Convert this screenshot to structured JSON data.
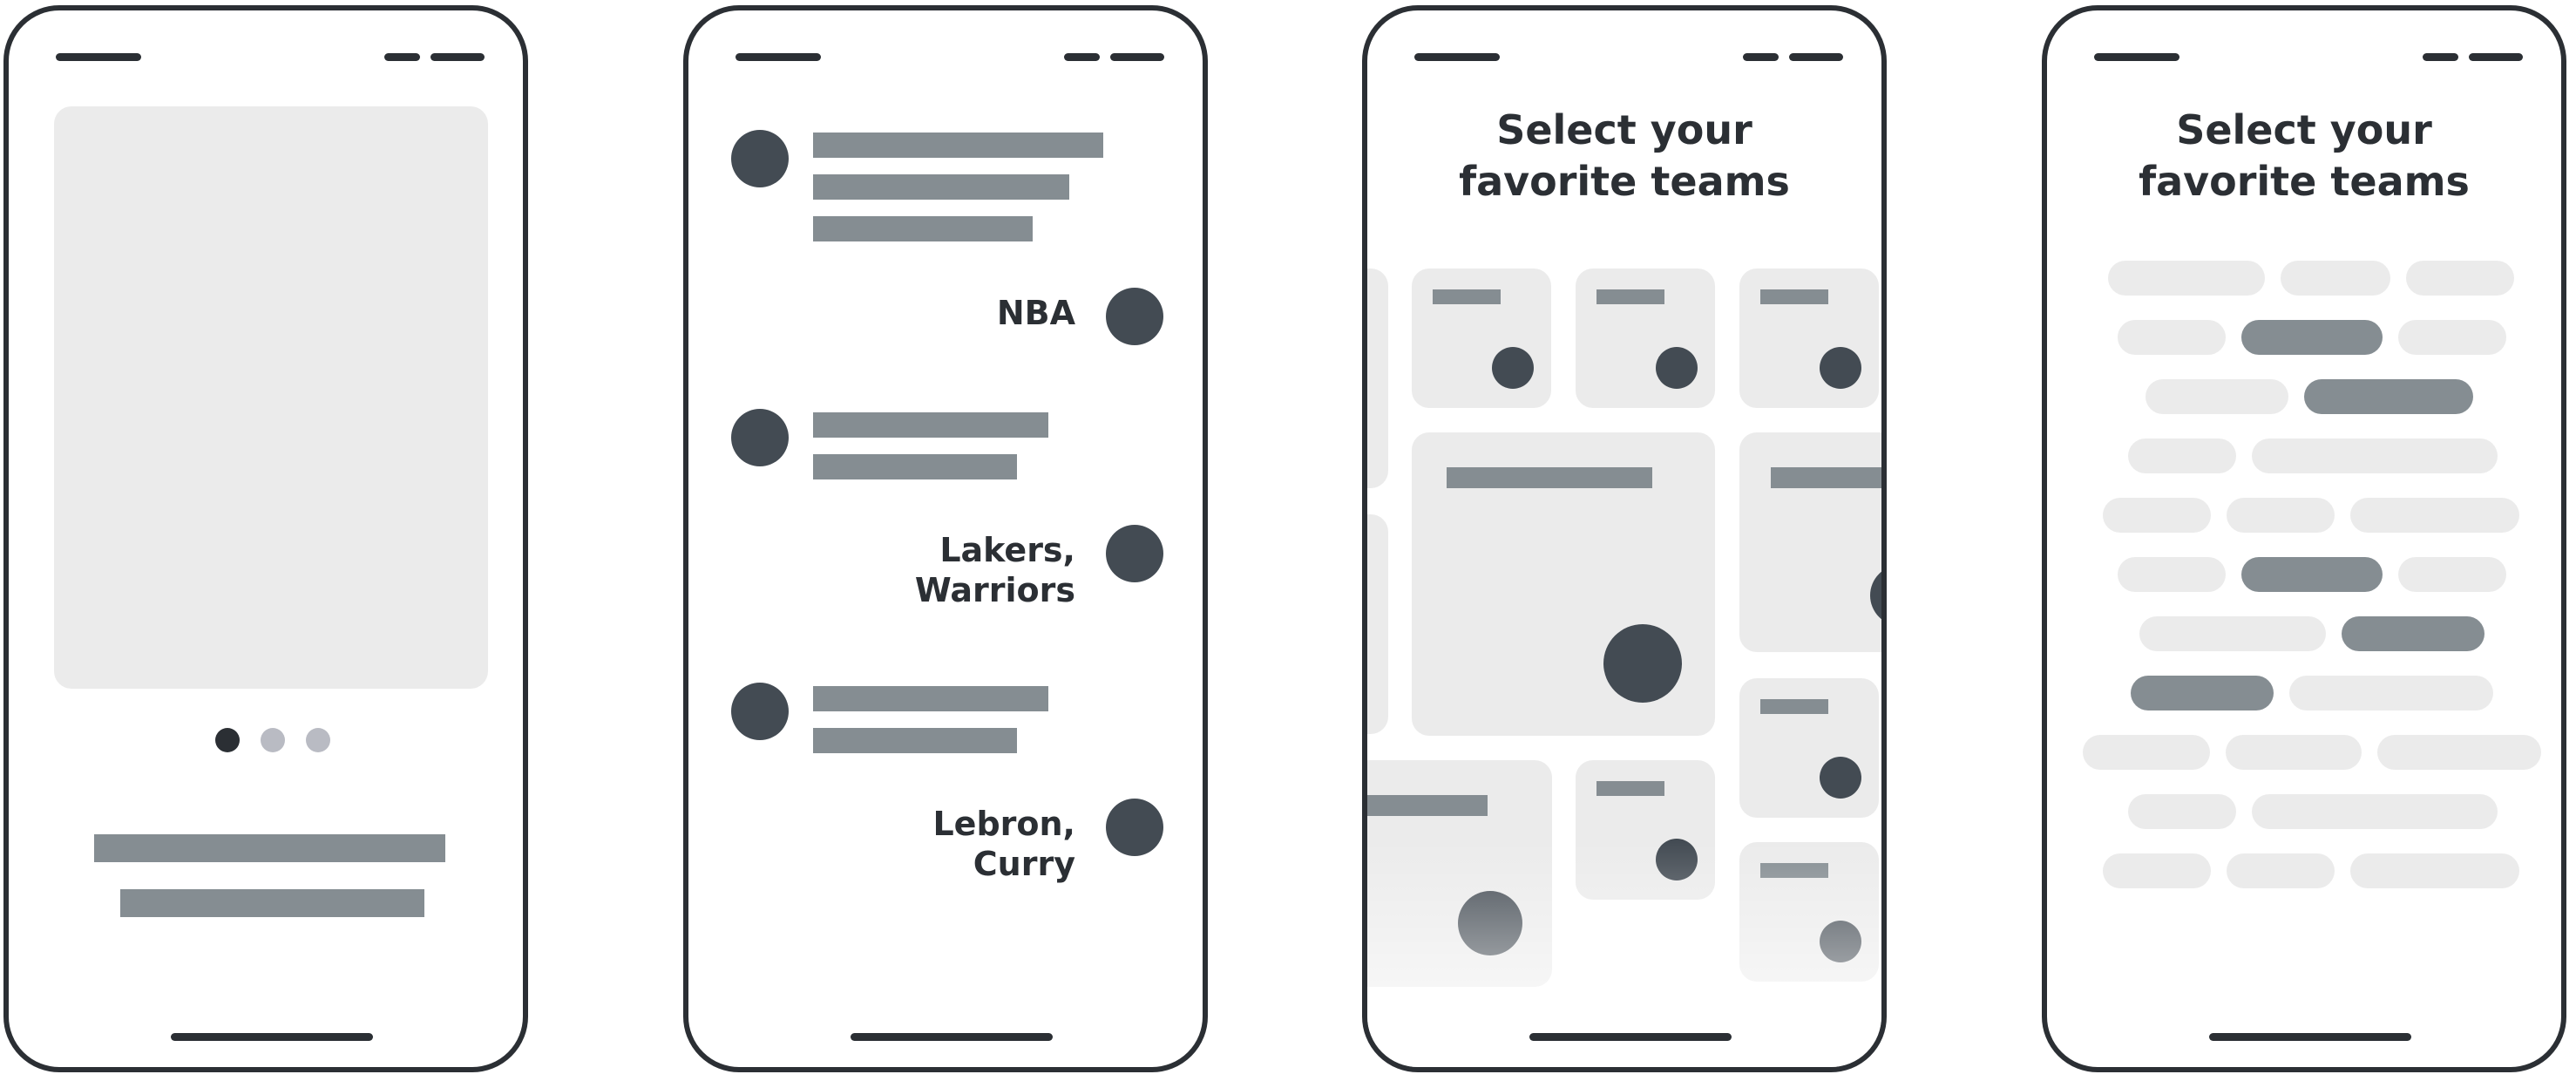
{
  "colors": {
    "outline": "#2b2f34",
    "placeholder_light": "#ebebeb",
    "placeholder_mid": "#858d92",
    "avatar_dark": "#434b53",
    "dot_inactive": "#b9bbc3"
  },
  "phone_2": {
    "labels": [
      "NBA",
      "Lakers,\nWarriors",
      "Lebron,\nCurry"
    ]
  },
  "phone_3": {
    "heading": "Select your\nfavorite teams"
  },
  "phone_4": {
    "heading": "Select your\nfavorite teams"
  },
  "pager": {
    "pages": 3,
    "current": 1
  }
}
